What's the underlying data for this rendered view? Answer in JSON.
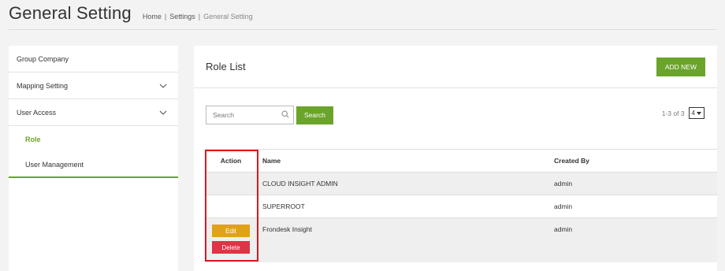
{
  "header": {
    "title": "General Setting",
    "breadcrumb": [
      "Home",
      "Settings",
      "General Setting"
    ],
    "separator": "|"
  },
  "sidebar": {
    "items": [
      {
        "label": "Group Company",
        "has_chevron": false
      },
      {
        "label": "Mapping Setting",
        "has_chevron": true,
        "icon": "chevron-down-icon"
      },
      {
        "label": "User Access",
        "has_chevron": true,
        "icon": "chevron-down-icon",
        "expanded": true
      }
    ],
    "sub_items": [
      {
        "label": "Role",
        "active": true
      },
      {
        "label": "User Management",
        "active": false
      }
    ],
    "accent_color": "#6aa42a"
  },
  "main": {
    "title": "Role List",
    "add_button": "ADD NEW",
    "search": {
      "placeholder": "Search",
      "value": "",
      "button": "Search",
      "icon": "search-icon"
    },
    "pager": {
      "range": "1-3 of 3",
      "page_size": "4"
    },
    "table": {
      "columns": [
        "Action",
        "Name",
        "Created By"
      ],
      "rows": [
        {
          "name": "CLOUD INSIGHT ADMIN",
          "created_by": "admin",
          "actions": []
        },
        {
          "name": "SUPERROOT",
          "created_by": "admin",
          "actions": []
        },
        {
          "name": "Frondesk Insight",
          "created_by": "admin",
          "actions": [
            "Edit",
            "Delete"
          ]
        }
      ]
    }
  },
  "colors": {
    "primary": "#6aa42a",
    "edit": "#e0a21a",
    "delete": "#dc3545",
    "highlight": "#e0161d"
  }
}
